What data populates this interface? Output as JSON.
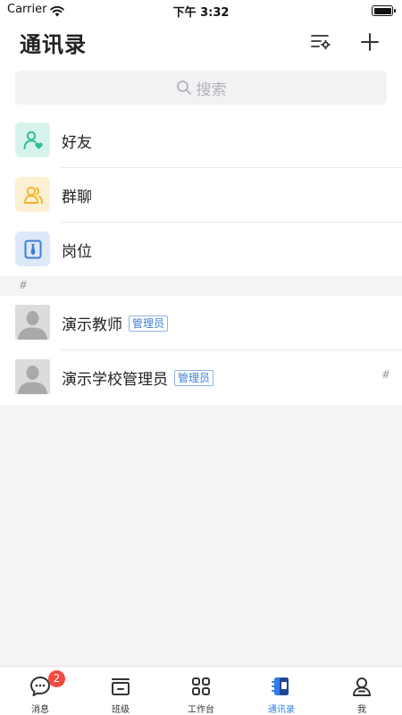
{
  "status_bar": {
    "carrier": "Carrier",
    "time": "下午 3:32"
  },
  "header": {
    "title": "通讯录"
  },
  "search": {
    "placeholder": "搜索"
  },
  "functions": [
    {
      "label": "好友",
      "icon": "friends-icon",
      "color": "#2ebf95"
    },
    {
      "label": "群聊",
      "icon": "group-chat-icon",
      "color": "#f2b42a"
    },
    {
      "label": "岗位",
      "icon": "position-icon",
      "color": "#3d7fd6"
    }
  ],
  "section": {
    "label": "#"
  },
  "contacts": [
    {
      "name": "演示教师",
      "badge": "管理员"
    },
    {
      "name": "演示学校管理员",
      "badge": "管理员"
    }
  ],
  "index_bar": {
    "hash": "#"
  },
  "tabs": [
    {
      "label": "消息",
      "icon": "message-icon",
      "badge": "2"
    },
    {
      "label": "班级",
      "icon": "class-icon"
    },
    {
      "label": "工作台",
      "icon": "workbench-icon"
    },
    {
      "label": "通讯录",
      "icon": "contacts-icon",
      "active": true
    },
    {
      "label": "我",
      "icon": "profile-icon"
    }
  ],
  "colors": {
    "accent": "#2f7ee5",
    "badge": "#f24a3e",
    "background": "#f4f4f5"
  }
}
